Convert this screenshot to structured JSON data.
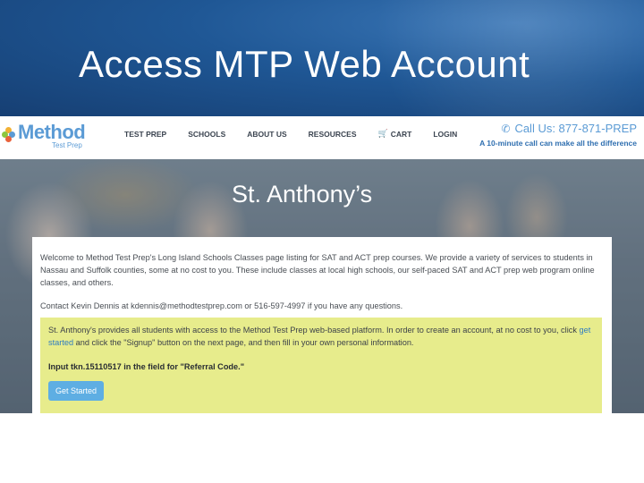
{
  "slide": {
    "title": "Access MTP Web Account"
  },
  "site": {
    "logo": {
      "name": "Method",
      "tagline": "Test Prep",
      "dot_colors": [
        "#f2b134",
        "#8cc63f",
        "#5b9bd5",
        "#e9623b"
      ]
    },
    "nav": {
      "items": [
        "TEST PREP",
        "SCHOOLS",
        "ABOUT US",
        "RESOURCES",
        "CART",
        "LOGIN"
      ]
    },
    "call": {
      "icon": "phone-icon",
      "label": "Call Us: 877-871-PREP",
      "subtext": "A 10-minute call can make all the difference"
    },
    "hero": {
      "title": "St. Anthony’s"
    },
    "content": {
      "intro": "Welcome to Method Test Prep's Long Island Schools Classes page listing for SAT and ACT prep courses. We provide a variety of services to students in Nassau and Suffolk counties, some at no cost to you. These include classes at local high schools, our self-paced SAT and ACT prep web program online classes, and others.",
      "contact": "Contact Kevin Dennis at kdennis@methodtestprep.com or 516-597-4997 if you have any questions.",
      "callout": {
        "text_before_link": "St. Anthony's provides all students with access to the Method Test Prep web-based platform. In order to create an account, at no cost to you, click ",
        "link_text": "get started",
        "text_after_link": " and click the \"Signup\" button on the next page, and then fill in your own personal information.",
        "referral": "Input tkn.15110517 in the field for \"Referral Code.\"",
        "button_label": "Get Started"
      }
    },
    "colors": {
      "brand_blue": "#5b9bd5",
      "callout_bg": "#e7ec8c",
      "button_bg": "#5eaee3",
      "header_blue": "#1f5795"
    }
  }
}
